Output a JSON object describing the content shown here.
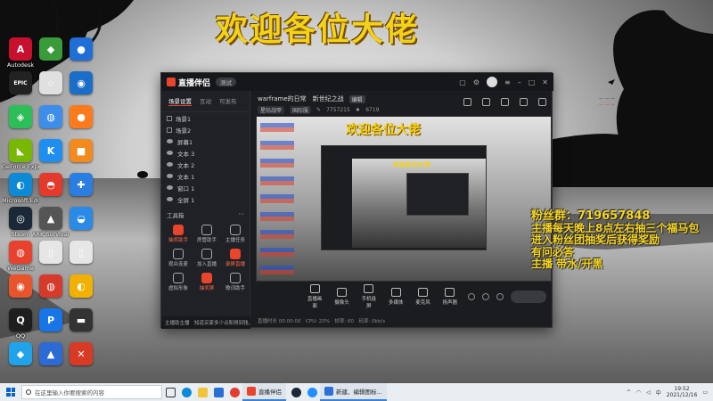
{
  "banner": {
    "text": "欢迎各位大佬"
  },
  "desktop_icons": [
    {
      "label": "Autodesk",
      "glyph": "A",
      "color": "#c8102e"
    },
    {
      "label": "",
      "glyph": "◆",
      "color": "#3a9b3a"
    },
    {
      "label": "",
      "glyph": "●",
      "color": "#1f6fd6"
    },
    {
      "label": "",
      "glyph": "EPIC",
      "color": "#222222"
    },
    {
      "label": "",
      "glyph": "☆",
      "color": "#e0e0e0"
    },
    {
      "label": "",
      "glyph": "◉",
      "color": "#1a6ec8"
    },
    {
      "label": "",
      "glyph": "◈",
      "color": "#2dbf57"
    },
    {
      "label": "",
      "glyph": "◍",
      "color": "#3d8ee8"
    },
    {
      "label": "",
      "glyph": "●",
      "color": "#ff7a1a"
    },
    {
      "label": "GeForce Experience",
      "glyph": "◣",
      "color": "#76b900"
    },
    {
      "label": "",
      "glyph": "K",
      "color": "#1f8ef1"
    },
    {
      "label": "",
      "glyph": "■",
      "color": "#f28a1e"
    },
    {
      "label": "Microsoft Edge",
      "glyph": "◐",
      "color": "#0c8ad6"
    },
    {
      "label": "",
      "glyph": "◓",
      "color": "#e33a2b"
    },
    {
      "label": "",
      "glyph": "✚",
      "color": "#2a7de1"
    },
    {
      "label": "Steam",
      "glyph": "◎",
      "color": "#1b2838"
    },
    {
      "label": "ARK Survival Evolved",
      "glyph": "▲",
      "color": "#555555"
    },
    {
      "label": "",
      "glyph": "◒",
      "color": "#2a8ae6"
    },
    {
      "label": "WeGame",
      "glyph": "◍",
      "color": "#e8412e"
    },
    {
      "label": "",
      "glyph": "▯",
      "color": "#e6e6e6"
    },
    {
      "label": "",
      "glyph": "▯",
      "color": "#e6e6e6"
    },
    {
      "label": "",
      "glyph": "◉",
      "color": "#e8552c"
    },
    {
      "label": "",
      "glyph": "◍",
      "color": "#d43b2b"
    },
    {
      "label": "",
      "glyph": "◐",
      "color": "#f2b100"
    },
    {
      "label": "QQ",
      "glyph": "Q",
      "color": "#1e1e1e"
    },
    {
      "label": "",
      "glyph": "P",
      "color": "#1775e8"
    },
    {
      "label": "",
      "glyph": "▬",
      "color": "#333333"
    },
    {
      "label": "",
      "glyph": "◆",
      "color": "#20a3e8"
    },
    {
      "label": "",
      "glyph": "▲",
      "color": "#2d6bd4"
    },
    {
      "label": "",
      "glyph": "✕",
      "color": "#d93a26"
    }
  ],
  "stream_app": {
    "title": "直播伴侣",
    "version_tag": "测试",
    "sidebar_tabs": [
      "场景设置",
      "互动",
      "可发布"
    ],
    "scenes": [
      "场景1",
      "场景2"
    ],
    "sources": [
      "屏幕1",
      "文本 3",
      "文本 2",
      "文本 1",
      "窗口 1",
      "全屏 1"
    ],
    "tools_heading": "工具箱",
    "tools": [
      {
        "label": "抽奖助手",
        "hot": true
      },
      {
        "label": "房管助手",
        "hot": false
      },
      {
        "label": "主播任务",
        "hot": false
      },
      {
        "label": "观众连麦",
        "hot": false
      },
      {
        "label": "加入直播",
        "hot": false
      },
      {
        "label": "录屏直播",
        "hot": true
      },
      {
        "label": "虚拟形象",
        "hot": false
      },
      {
        "label": "抽奖屏",
        "hot": true
      },
      {
        "label": "歌词助手",
        "hot": false
      }
    ],
    "footer_text": "主播助主播　知道买家多少点和得到钱，请立即联系与联系我",
    "room_title": "warframe的日常　新世纪之战",
    "room_edit": "编辑",
    "room_tags": [
      "星际战甲",
      "国际服"
    ],
    "room_id": "7757215",
    "fans": "6719",
    "bottom_buttons": [
      "直播画面",
      "摄像头",
      "手机投屏",
      "多媒体",
      "麦克风",
      "扬声器"
    ],
    "status_text": "直播时长 00:00:00　CPU: 23%　帧率: 60　码率: 0kb/s"
  },
  "overlay": {
    "qq_line": "粉丝群：719657848",
    "lines": [
      "主播每天晚上8点左右抽三个福马包",
      "进入粉丝团抽奖后获得奖励",
      "有问必答",
      "主播 带水/开黑"
    ]
  },
  "taskbar": {
    "search_placeholder": "在这里输入你要搜索的内容",
    "apps": [
      {
        "label": "直播伴侣",
        "color": "#e8452c"
      },
      {
        "label": "新建、编辑图标...",
        "color": "#2e6fd8"
      }
    ],
    "time": "19:52",
    "date": "2021/12/16",
    "lang": "中"
  }
}
